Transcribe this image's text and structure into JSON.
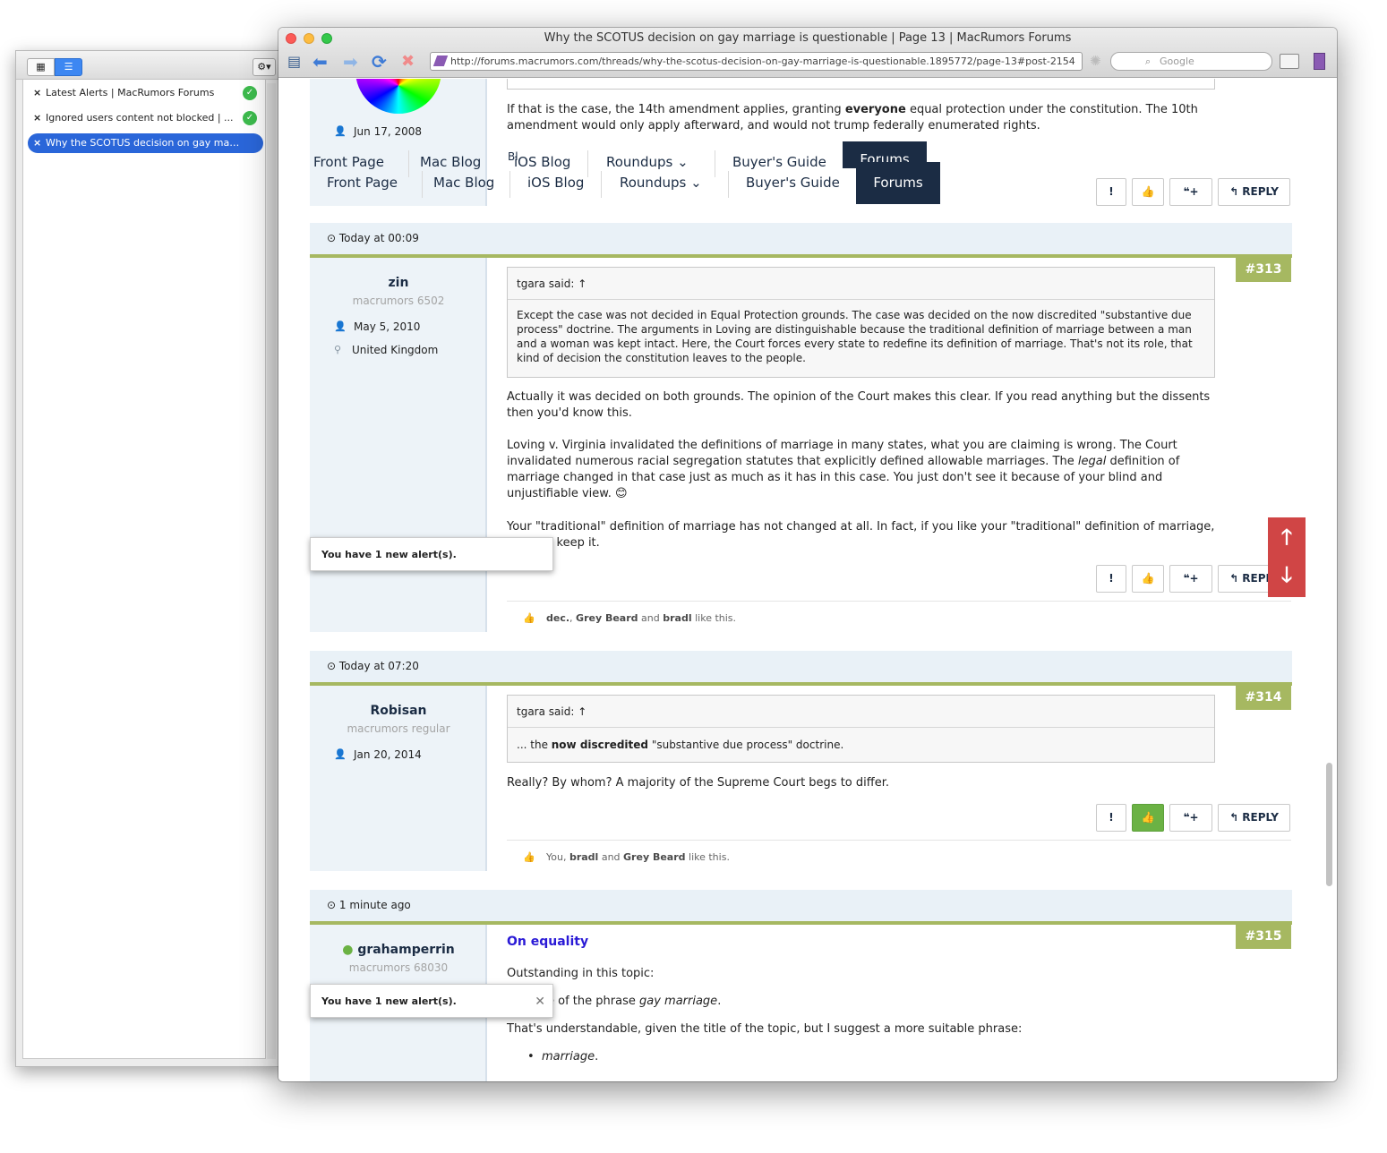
{
  "sidebar": {
    "items": [
      {
        "label": "Latest Alerts | MacRumors Forums",
        "close": "×",
        "status": "✓"
      },
      {
        "label": "Ignored users content not blocked | ...",
        "close": "×",
        "status": "✓"
      },
      {
        "label": "Why the SCOTUS decision on gay marriage...",
        "close": "×"
      }
    ],
    "view_icons": [
      "grid-view-icon",
      "list-view-icon"
    ],
    "gear_icon": "gear-icon"
  },
  "browser": {
    "title": "Why the SCOTUS decision on gay marriage is questionable | Page 13 | MacRumors Forums",
    "url": "http://forums.macrumors.com/threads/why-the-scotus-decision-on-gay-marriage-is-questionable.1895772/page-13#post-2154",
    "search_placeholder": "Google",
    "icons": {
      "back": "⬅",
      "forward": "➡",
      "reload": "⟳",
      "stop": "✖",
      "sidebar": "▤"
    }
  },
  "nav": {
    "items": [
      "Front Page",
      "Mac Blog",
      "iOS Blog",
      "Roundups",
      "Buyer's Guide",
      "Forums"
    ],
    "overlay_top": [
      "Front Page",
      "Mac Blog",
      "iOS Blog",
      "Roundups",
      "Buyer's Guide",
      "Forums"
    ],
    "clip_label": "Bl"
  },
  "post_prev": {
    "joined": "Jun 17, 2008",
    "text_html": "If that is the case, the 14th amendment applies, granting <b>everyone</b> equal protection under the constitution. The 10th amendment would only apply afterward, and would not trump federally enumerated rights."
  },
  "actions": {
    "report": "!",
    "like": "👍",
    "multiquote": "❝+",
    "reply": "↰ REPLY"
  },
  "posts": [
    {
      "date": "Today at 00:09",
      "number": "#313",
      "user": "zin",
      "title": "macrumors 6502",
      "joined": "May 5, 2010",
      "location": "United Kingdom",
      "quote_head": "tgara said: ↑",
      "quote_body": "Except the case was not decided in Equal Protection grounds. The case was decided on the now discredited \"substantive due process\" doctrine. The arguments in Loving are distinguishable because the traditional definition of marriage between a man and a woman was kept intact. Here, the Court forces every state to redefine its definition of marriage. That's not its role, that kind of decision the constitution leaves to the people.",
      "p1": "Actually it was decided on both grounds. The opinion of the Court makes this clear. If you read anything but the dissents then you'd know this.",
      "p2_html": "Loving v. Virginia invalidated the definitions of marriage in many states, what you are claiming is wrong. The Court invalidated numerous racial segregation statutes that explicitly defined allowable marriages. The <i>legal</i> definition of marriage changed in that case just as much as it has in this case. You just don't see it because of your blind and unjustifiable view. 😊",
      "p3": "Your \"traditional\" definition of marriage has not changed at all. In fact, if you like your \"traditional\" definition of marriage, you can keep it.",
      "likes_html": "<b>dec.</b>, <b>Grey Beard</b> and <b>bradl</b> like this."
    },
    {
      "date": "Today at 07:20",
      "number": "#314",
      "user": "Robisan",
      "title": "macrumors regular",
      "joined": "Jan 20, 2014",
      "quote_head": "tgara said: ↑",
      "quote_body_html": "... the <b>now discredited</b> \"substantive due process\" doctrine.",
      "p1": "Really? By whom? A majority of the Supreme Court begs to differ.",
      "likes_html": "You, <b>bradl</b> and <b>Grey Beard</b> like this."
    },
    {
      "date": "1 minute ago",
      "number": "#315",
      "user": "grahamperrin",
      "title": "macrumors 68030",
      "heading": "On equality",
      "p1": "Outstanding in this topic:",
      "p2_html": "use of the phrase <i>gay marriage</i>.",
      "p3": "That's understandable, given the title of the topic, but I suggest a more suitable phrase:",
      "bullet_html": "<i>marriage</i>."
    }
  ],
  "alerts": [
    {
      "text": "You have 1 new alert(s)."
    },
    {
      "text": "You have 1 new alert(s).",
      "close": "✕"
    }
  ]
}
